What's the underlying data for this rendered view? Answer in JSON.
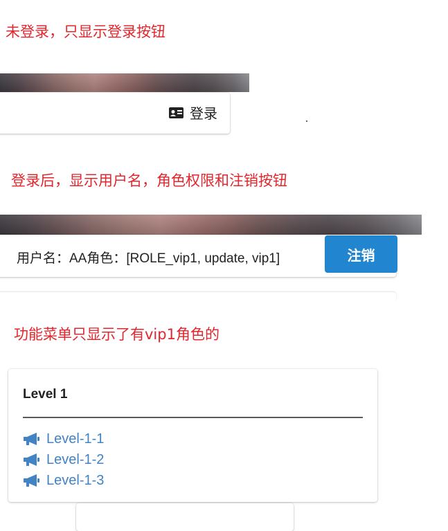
{
  "notes": {
    "logged_out": "未登录，只显示登录按钮",
    "logged_in": "登录后，显示用户名，角色权限和注销按钮",
    "menu": "功能菜单只显示了有vip1角色的"
  },
  "logged_out_bar": {
    "login_label": "登录",
    "login_icon": "id-card-icon"
  },
  "logged_in_bar": {
    "user_info": "用户名：AA角色：[ROLE_vip1, update, vip1]",
    "logout_label": "注销"
  },
  "level_card": {
    "title": "Level 1",
    "items": [
      {
        "label": "Level-1-1",
        "icon": "bullhorn-icon"
      },
      {
        "label": "Level-1-2",
        "icon": "bullhorn-icon"
      },
      {
        "label": "Level-1-3",
        "icon": "bullhorn-icon"
      }
    ]
  },
  "colors": {
    "note_red": "#e2262c",
    "primary_blue": "#2185d0",
    "link_blue": "#4183c4"
  }
}
